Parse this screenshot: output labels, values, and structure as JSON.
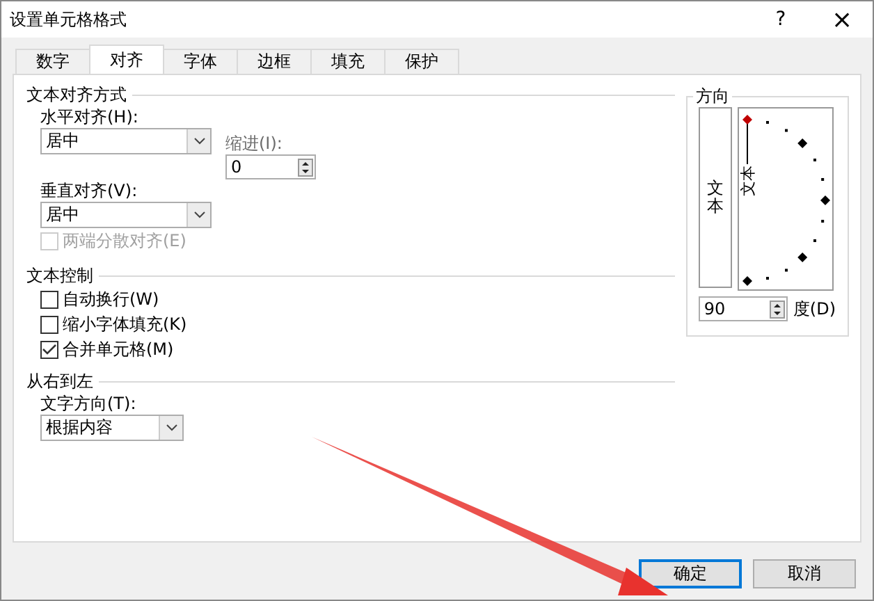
{
  "window": {
    "title": "设置单元格格式",
    "help": "?",
    "close": "×"
  },
  "tabs": [
    {
      "label": "数字",
      "selected": false
    },
    {
      "label": "对齐",
      "selected": true
    },
    {
      "label": "字体",
      "selected": false
    },
    {
      "label": "边框",
      "selected": false
    },
    {
      "label": "填充",
      "selected": false
    },
    {
      "label": "保护",
      "selected": false
    }
  ],
  "text_alignment": {
    "title": "文本对齐方式",
    "horizontal": {
      "label": "水平对齐(H):",
      "value": "居中"
    },
    "indent": {
      "label": "缩进(I):",
      "value": "0"
    },
    "vertical": {
      "label": "垂直对齐(V):",
      "value": "居中"
    },
    "distributed": {
      "label": "两端分散对齐(E)",
      "checked": false,
      "disabled": true
    }
  },
  "text_control": {
    "title": "文本控制",
    "options": [
      {
        "label": "自动换行(W)",
        "checked": false
      },
      {
        "label": "缩小字体填充(K)",
        "checked": false
      },
      {
        "label": "合并单元格(M)",
        "checked": true
      }
    ]
  },
  "right_to_left": {
    "title": "从右到左",
    "direction": {
      "label": "文字方向(T):",
      "value": "根据内容"
    }
  },
  "orientation": {
    "title": "方向",
    "vertical_text": "文本",
    "dial_text": "文本",
    "degrees": "90",
    "degrees_label": "度(D)"
  },
  "buttons": [
    {
      "label": "确定",
      "default": true
    },
    {
      "label": "取消",
      "default": false
    }
  ]
}
